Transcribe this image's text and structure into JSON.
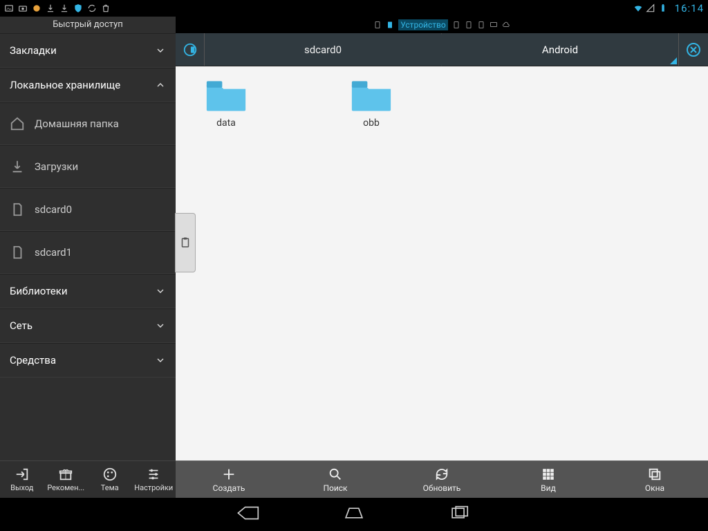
{
  "status": {
    "clock": "16:14"
  },
  "tabstrip": {
    "active_label": "Устройство"
  },
  "sidebar": {
    "title": "Быстрый доступ",
    "sections": {
      "bookmarks": "Закладки",
      "local": "Локальное хранилище",
      "libraries": "Библиотеки",
      "network": "Сеть",
      "tools": "Средства"
    },
    "local_items": {
      "home": "Домашняя папка",
      "downloads": "Загрузки",
      "sd0": "sdcard0",
      "sd1": "sdcard1"
    },
    "bottom": {
      "exit": "Выход",
      "recommend": "Рекомен...",
      "theme": "Тема",
      "settings": "Настройки"
    }
  },
  "path": {
    "seg0": "sdcard0",
    "seg1": "Android"
  },
  "folders": {
    "f0": "data",
    "f1": "obb"
  },
  "mainbar": {
    "create": "Создать",
    "search": "Поиск",
    "refresh": "Обновить",
    "view": "Вид",
    "windows": "Окна"
  }
}
